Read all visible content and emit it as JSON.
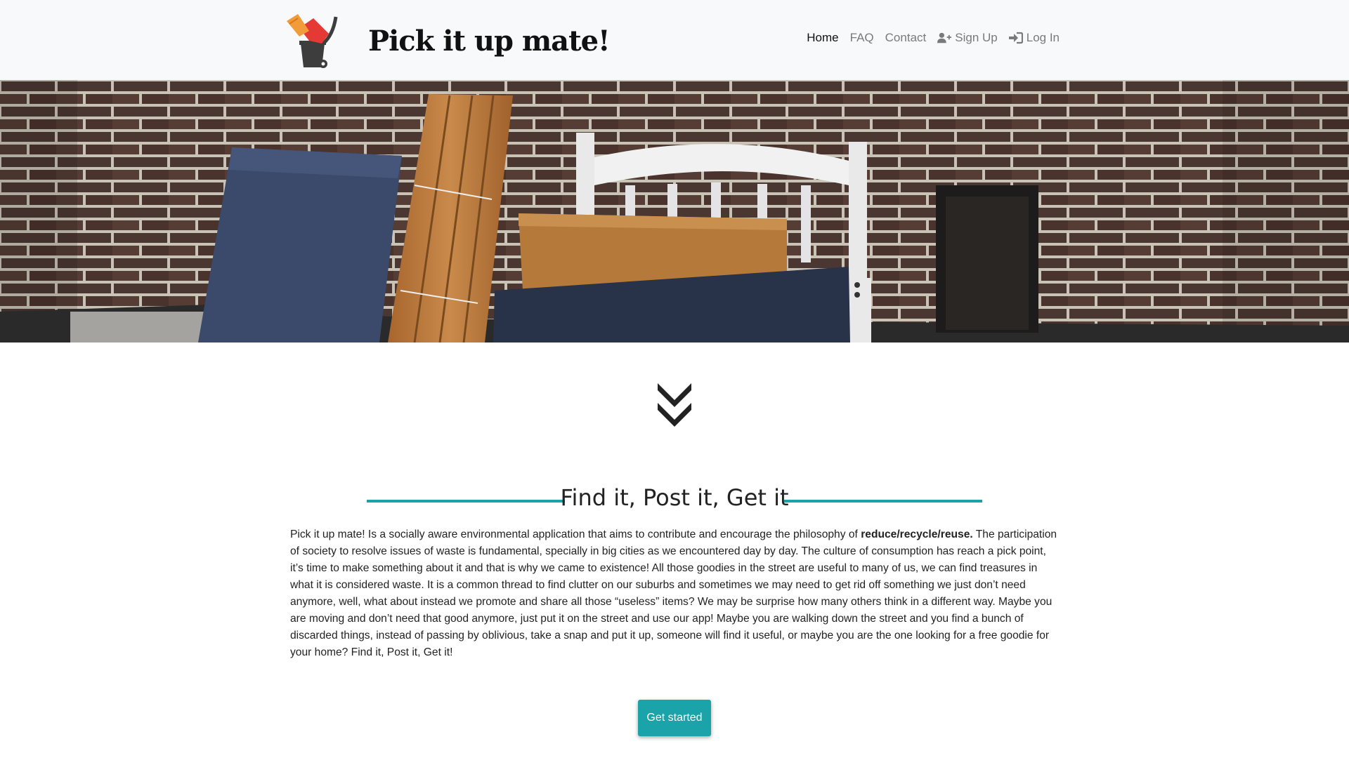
{
  "brand": {
    "title": "Pick it up mate!",
    "logo_icon": "trash-bin-with-broom-logo-icon"
  },
  "nav": {
    "items": [
      {
        "label": "Home",
        "active": true,
        "icon": ""
      },
      {
        "label": "FAQ",
        "active": false,
        "icon": ""
      },
      {
        "label": "Contact",
        "active": false,
        "icon": ""
      },
      {
        "label": "Sign Up",
        "active": false,
        "icon": "user-plus-icon"
      },
      {
        "label": "Log In",
        "active": false,
        "icon": "sign-in-icon"
      }
    ]
  },
  "hero": {
    "image_subject": "discarded furniture leaning against a brick wall"
  },
  "section": {
    "scroll_icon": "double-chevron-down-icon",
    "title": "Find it, Post it, Get it",
    "paragraph_intro": "Pick it up mate! Is a socially aware environmental application that aims to contribute and encourage the philosophy of ",
    "paragraph_bold": "reduce/recycle/reuse.",
    "paragraph_rest": " The participation of society to resolve issues of waste is fundamental, specially in big cities as we encountered day by day. The culture of consumption has reach a pick point, it’s time to make something about it and that is why we came to existence! All those goodies in the street are useful to many of us, we can find treasures in what it is considered waste. It is a common thread to find clutter on our suburbs and sometimes we may need to get rid off something we just don’t need anymore, well, what about instead we promote and share all those “useless” items? We may be surprise how many others think in a different way. Maybe you are moving and don’t need that good anymore, just put it on the street and use our app! Maybe you are walking down the street and you find a bunch of discarded things, instead of passing by oblivious, take a snap and put it up, someone will find it useful, or maybe you are the one looking for a free goodie for your home? Find it, Post it, Get it!",
    "cta_label": "Get started"
  },
  "colors": {
    "accent": "#1aa3a8",
    "navbar_bg": "#f8f9fa",
    "text": "#222222"
  }
}
